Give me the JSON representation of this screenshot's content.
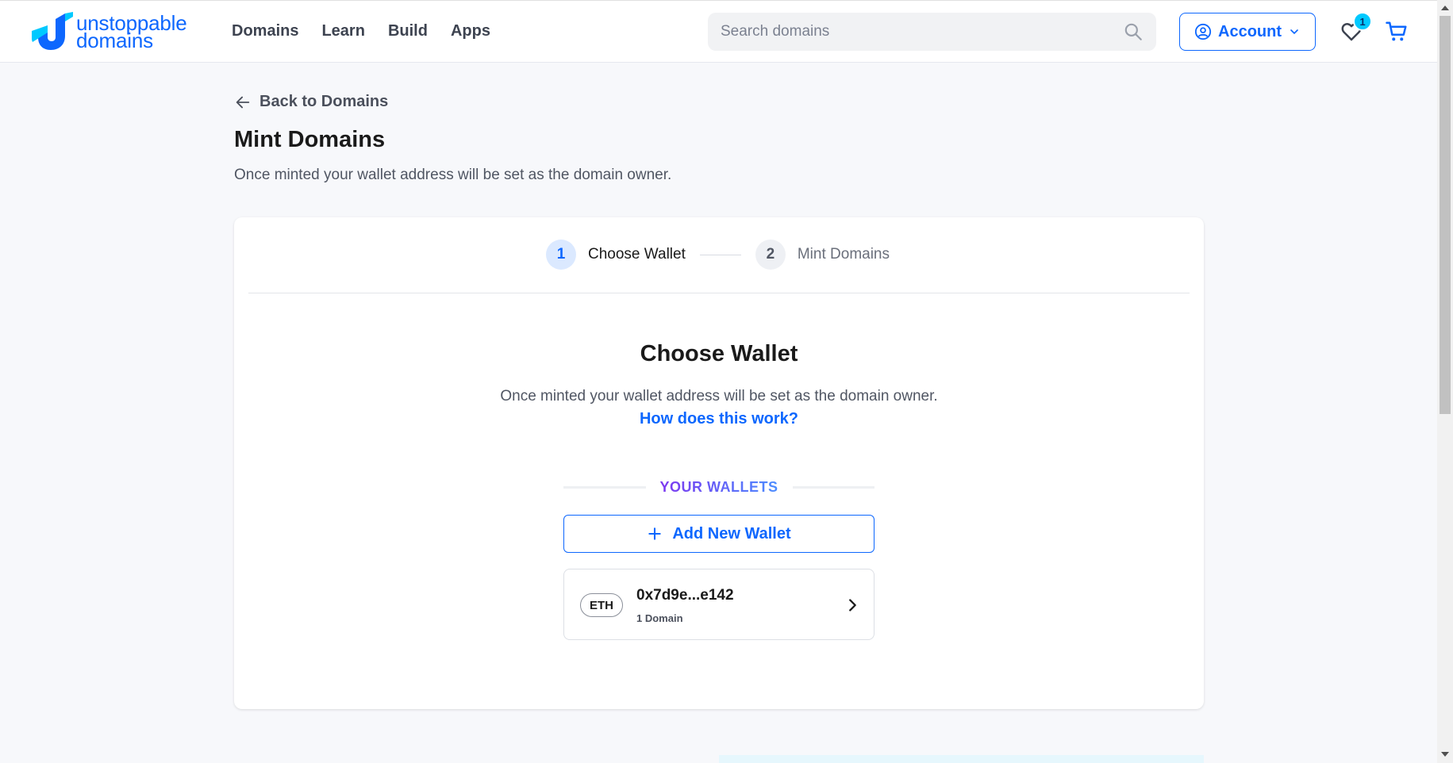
{
  "brand": {
    "name_line1": "unstoppable",
    "name_line2": "domains",
    "color": "#0d67fe"
  },
  "nav": {
    "items": [
      {
        "label": "Domains"
      },
      {
        "label": "Learn"
      },
      {
        "label": "Build"
      },
      {
        "label": "Apps"
      }
    ]
  },
  "search": {
    "placeholder": "Search domains",
    "icon": "search-icon"
  },
  "account": {
    "label": "Account",
    "icon": "user-circle-icon"
  },
  "favorites": {
    "count": "1",
    "icon": "heart-icon"
  },
  "cart": {
    "icon": "cart-icon"
  },
  "back": {
    "label": "Back to Domains"
  },
  "page": {
    "title": "Mint Domains",
    "subtitle": "Once minted your wallet address will be set as the domain owner."
  },
  "stepper": {
    "steps": [
      {
        "number": "1",
        "label": "Choose Wallet",
        "active": true
      },
      {
        "number": "2",
        "label": "Mint Domains",
        "active": false
      }
    ]
  },
  "choose_wallet": {
    "title": "Choose Wallet",
    "description": "Once minted your wallet address will be set as the domain owner.",
    "help_link": "How does this work?",
    "section_label": "YOUR WALLETS",
    "add_button": "Add New Wallet",
    "wallets": [
      {
        "chain": "ETH",
        "address": "0x7d9e...e142",
        "domains": "1 Domain"
      }
    ]
  },
  "colors": {
    "accent": "#0d67fe",
    "badge": "#00c9ff",
    "background": "#f7f8fb"
  }
}
